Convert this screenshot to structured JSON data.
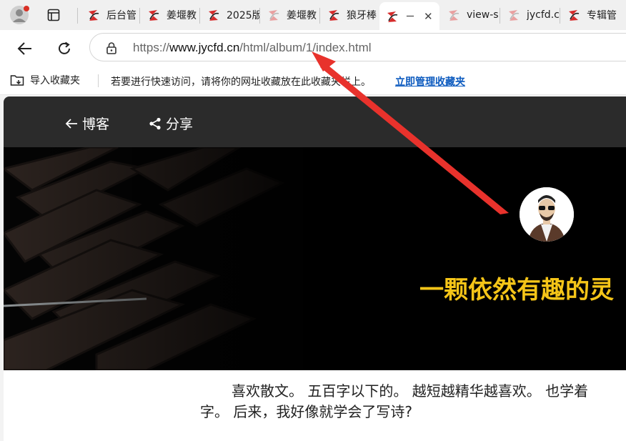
{
  "browser": {
    "tabs": [
      {
        "title": "后台管",
        "active": false
      },
      {
        "title": "姜堰教",
        "active": false
      },
      {
        "title": "2025版",
        "active": false
      },
      {
        "title": "姜堰教",
        "active": false
      },
      {
        "title": "狼牙棒",
        "active": false
      },
      {
        "title": "－",
        "active": true
      },
      {
        "title": "view-s",
        "active": false
      },
      {
        "title": "jycfd.c",
        "active": false
      },
      {
        "title": "专辑管",
        "active": false
      }
    ],
    "tab_close_glyph": "✕",
    "url": {
      "scheme": "https://",
      "host": "www.jycfd.cn",
      "path": "/html/album/1/index.html"
    },
    "bookmarks": {
      "import_label": "导入收藏夹",
      "hint": "若要进行快速访问，请将你的网址收藏放在此收藏夹栏上。",
      "manage_link": "立即管理收藏夹"
    }
  },
  "site": {
    "nav": [
      {
        "label": "博客",
        "icon": "arrow-left-icon"
      },
      {
        "label": "分享",
        "icon": "share-icon"
      }
    ],
    "hero_slogan": "一颗依然有趣的灵",
    "intro_line1": "喜欢散文。 五百字以下的。 越短越精华越喜欢。 也学着",
    "intro_line2": "字。 后来，我好像就学会了写诗?"
  },
  "colors": {
    "slogan": "#f5c518",
    "link": "#0d5bbf",
    "annotation_arrow": "#e8322c",
    "nav_bg": "#2b2b2b"
  }
}
